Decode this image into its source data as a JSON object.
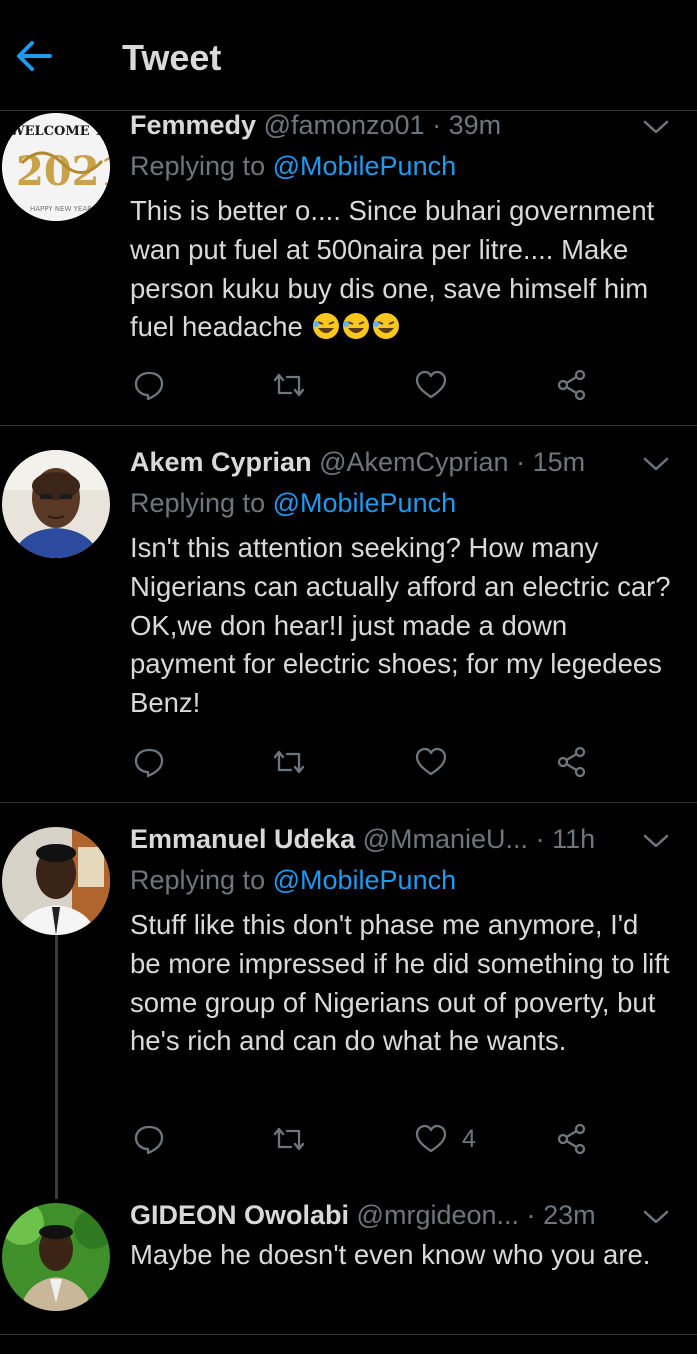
{
  "header": {
    "title": "Tweet"
  },
  "tweets": [
    {
      "name": "Femmedy",
      "handle": "@famonzo01",
      "separator": "·",
      "time": "39m",
      "replying_prefix": "Replying to ",
      "replying_to": "@MobilePunch",
      "text": "This is better o.... Since buhari government wan put fuel at 500naira per litre.... Make person kuku buy dis one, save himself him fuel headache",
      "emoji": "rolling-on-floor-laughing x3",
      "like_count": ""
    },
    {
      "name": "Akem Cyprian",
      "handle": "@AkemCyprian",
      "separator": "·",
      "time": "15m",
      "replying_prefix": "Replying to ",
      "replying_to": "@MobilePunch",
      "text": "Isn't this attention seeking? How many Nigerians can actually afford an electric car?OK,we don hear!I just made a down payment for electric shoes; for my legedees Benz!",
      "like_count": ""
    },
    {
      "name": "Emmanuel Udeka",
      "handle": "@MmanieU...",
      "separator": "·",
      "time": "11h",
      "replying_prefix": "Replying to ",
      "replying_to": "@MobilePunch",
      "text": "Stuff like this don't phase me anymore, I'd be more impressed if he did something to lift some group of Nigerians out of poverty, but he's rich and can do what he wants.",
      "like_count": "4"
    },
    {
      "name": "GIDEON Owolabi",
      "handle": "@mrgideon...",
      "separator": "·",
      "time": "23m",
      "text": "Maybe he doesn't even know who you are."
    }
  ],
  "icons": {
    "back": "back-arrow-icon",
    "caret": "chevron-down-icon",
    "reply": "reply-icon",
    "retweet": "retweet-icon",
    "like": "heart-icon",
    "share": "share-icon"
  },
  "colors": {
    "background": "#000000",
    "text": "#d9d9d9",
    "muted": "#6e767d",
    "accent": "#1d9bf0",
    "divider": "#2f3336"
  }
}
